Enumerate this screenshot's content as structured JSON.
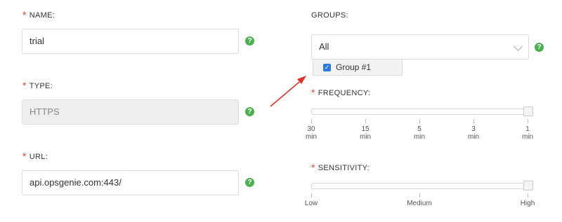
{
  "name": {
    "label": "NAME:",
    "value": "trial"
  },
  "type": {
    "label": "TYPE:",
    "value": "HTTPS"
  },
  "url": {
    "label": "URL:",
    "value": "api.opsgenie.com:443/"
  },
  "groups": {
    "label": "GROUPS:",
    "selected": "All",
    "dropdown_item": "Group #1",
    "dropdown_item_checked": true
  },
  "frequency": {
    "label": "FREQUENCY:",
    "ticks": [
      {
        "value": "30",
        "unit": "min"
      },
      {
        "value": "15",
        "unit": "min"
      },
      {
        "value": "5",
        "unit": "min"
      },
      {
        "value": "3",
        "unit": "min"
      },
      {
        "value": "1",
        "unit": "min"
      }
    ],
    "selected": "1 min"
  },
  "sensitivity": {
    "label": "SENSITIVITY:",
    "ticks": [
      "Low",
      "Medium",
      "High"
    ],
    "selected": "High"
  },
  "required_marker": "*",
  "help_glyph": "?",
  "colors": {
    "required": "#e0442c",
    "help": "#4caf50",
    "checkbox": "#2a7ae2",
    "arrow": "#e0302c"
  }
}
